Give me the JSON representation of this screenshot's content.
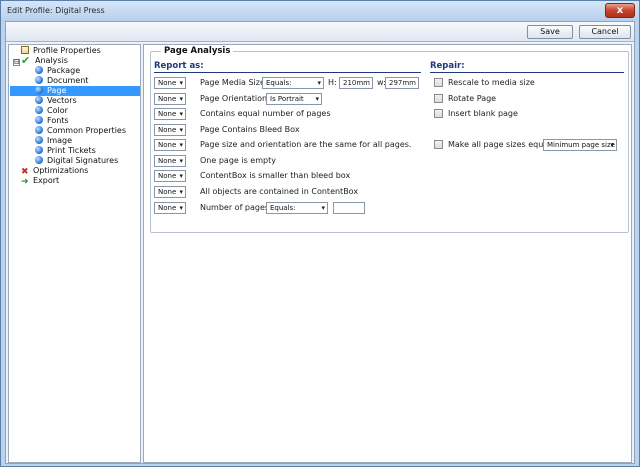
{
  "window": {
    "title": "Edit Profile: Digital Press",
    "close_label": "x"
  },
  "toolbar": {
    "save_label": "Save",
    "cancel_label": "Cancel"
  },
  "tree": {
    "items": [
      {
        "label": "Profile Properties",
        "icon": "page-icon"
      },
      {
        "label": "Analysis",
        "icon": "check-icon"
      },
      {
        "label": "Package",
        "icon": "dot-icon"
      },
      {
        "label": "Document",
        "icon": "dot-icon"
      },
      {
        "label": "Page",
        "icon": "dot-icon",
        "selected": true
      },
      {
        "label": "Vectors",
        "icon": "dot-icon"
      },
      {
        "label": "Color",
        "icon": "dot-icon"
      },
      {
        "label": "Fonts",
        "icon": "dot-icon"
      },
      {
        "label": "Common Properties",
        "icon": "dot-icon"
      },
      {
        "label": "Image",
        "icon": "dot-icon"
      },
      {
        "label": "Print Tickets",
        "icon": "dot-icon"
      },
      {
        "label": "Digital Signatures",
        "icon": "dot-icon"
      },
      {
        "label": "Optimizations",
        "icon": "tools-icon"
      },
      {
        "label": "Export",
        "icon": "export-icon"
      }
    ],
    "expander": "⊟"
  },
  "analysis": {
    "group_title": "Page Analysis",
    "report_header": "Report as:",
    "repair_header": "Repair:",
    "rows": [
      {
        "report": "None",
        "label": "Page Media Size:"
      },
      {
        "report": "None",
        "label": "Page Orientation:"
      },
      {
        "report": "None",
        "label": "Contains equal number of pages"
      },
      {
        "report": "None",
        "label": "Page Contains Bleed Box"
      },
      {
        "report": "None",
        "label": "Page size and orientation are the same for all pages."
      },
      {
        "report": "None",
        "label": "One page is empty"
      },
      {
        "report": "None",
        "label": "ContentBox is smaller than bleed box"
      },
      {
        "report": "None",
        "label": "All objects are contained in ContentBox"
      },
      {
        "report": "None",
        "label": "Number of pages:"
      }
    ],
    "media_size": {
      "mode": "Equals:",
      "h_label": "H:",
      "h_value": "210mm",
      "w_label": "w:",
      "w_value": "297mm"
    },
    "orientation": {
      "value": "Is Portrait"
    },
    "num_pages": {
      "mode": "Equals:",
      "value": ""
    },
    "repairs": [
      {
        "label": "Rescale to media size"
      },
      {
        "label": "Rotate Page"
      },
      {
        "label": "Insert blank page"
      },
      {
        "label": "Make all page sizes equal:",
        "option": "Minimum page size"
      }
    ]
  }
}
